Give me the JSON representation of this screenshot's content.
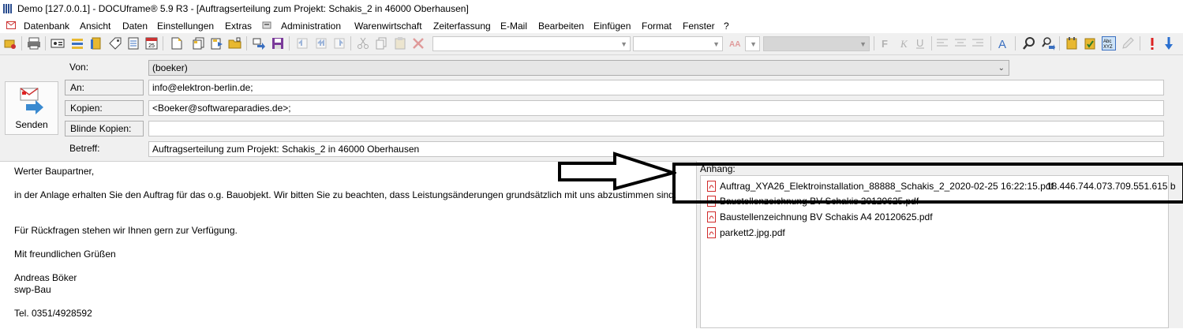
{
  "window": {
    "title": "Demo [127.0.0.1] - DOCUframe® 5.9 R3 - [Auftragserteilung zum Projekt: Schakis_2 in 46000 Oberhausen]"
  },
  "menu": {
    "items": [
      "Datenbank",
      "Ansicht",
      "Daten",
      "Einstellungen",
      "Extras",
      "Administration",
      "Warenwirtschaft",
      "Zeiterfassung",
      "E-Mail",
      "Bearbeiten",
      "Einfügen",
      "Format",
      "Fenster",
      "?"
    ]
  },
  "form": {
    "send_label": "Senden",
    "von_label": "Von:",
    "von_value": "(boeker)",
    "an_label": "An:",
    "an_value": "info@elektron-berlin.de;",
    "kopien_label": "Kopien:",
    "kopien_value": "<Boeker@softwareparadies.de>;",
    "bcc_label": "Blinde Kopien:",
    "bcc_value": "",
    "betreff_label": "Betreff:",
    "betreff_value": "Auftragserteilung zum Projekt: Schakis_2 in 46000 Oberhausen"
  },
  "body": {
    "lines": [
      "Werter Baupartner,",
      "in der Anlage erhalten Sie den Auftrag für das o.g. Bauobjekt. Wir bitten Sie zu beachten, dass Leistungsänderungen grundsätzlich mit uns abzustimmen sind.",
      "Für Rückfragen stehen wir Ihnen gern zur Verfügung.",
      "Mit freundlichen Grüßen",
      "Andreas Böker",
      "swp-Bau",
      "Tel. 0351/4928592"
    ]
  },
  "attachments": {
    "title": "Anhang:",
    "items": [
      {
        "name": "Auftrag_XYA26_Elektroinstallation_88888_Schakis_2_2020-02-25 16:22:15.pdf",
        "size": "18.446.744.073.709.551.615 b"
      },
      {
        "name": "Baustellenzeichnung BV Schakis 20120625.pdf",
        "size": ""
      },
      {
        "name": "Baustellenzeichnung BV Schakis A4 20120625.pdf",
        "size": ""
      },
      {
        "name": "parkett2.jpg.pdf",
        "size": ""
      }
    ]
  },
  "colors": {
    "pdf_icon": "#d12b2b",
    "toolbar_bg": "#f0f0f0",
    "annotation": "#000000"
  }
}
